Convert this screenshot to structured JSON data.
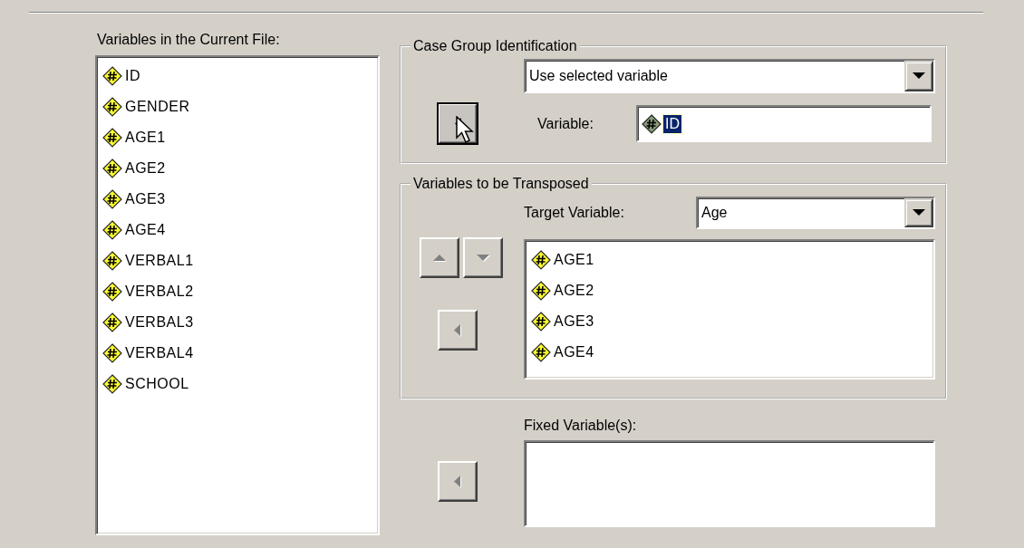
{
  "current_file": {
    "label": "Variables in the Current File:",
    "items": [
      {
        "name": "ID"
      },
      {
        "name": "GENDER"
      },
      {
        "name": "AGE1"
      },
      {
        "name": "AGE2"
      },
      {
        "name": "AGE3"
      },
      {
        "name": "AGE4"
      },
      {
        "name": "VERBAL1"
      },
      {
        "name": "VERBAL2"
      },
      {
        "name": "VERBAL3"
      },
      {
        "name": "VERBAL4"
      },
      {
        "name": "SCHOOL"
      }
    ]
  },
  "case_group": {
    "title": "Case Group Identification",
    "mode": {
      "value": "Use selected variable"
    },
    "move_button": {
      "kind": "left",
      "disabled": false,
      "focused": true
    },
    "variable": {
      "label": "Variable:",
      "value": "ID",
      "selected": true
    }
  },
  "transpose": {
    "title": "Variables to be Transposed",
    "target": {
      "label": "Target Variable:",
      "value": "Age"
    },
    "order_buttons": [
      {
        "kind": "up",
        "disabled": true
      },
      {
        "kind": "down",
        "disabled": true
      }
    ],
    "move_button": {
      "kind": "left",
      "disabled": true
    },
    "items": [
      {
        "name": "AGE1"
      },
      {
        "name": "AGE2"
      },
      {
        "name": "AGE3"
      },
      {
        "name": "AGE4"
      }
    ]
  },
  "fixed": {
    "label": "Fixed Variable(s):",
    "move_button": {
      "kind": "left",
      "disabled": true
    }
  }
}
